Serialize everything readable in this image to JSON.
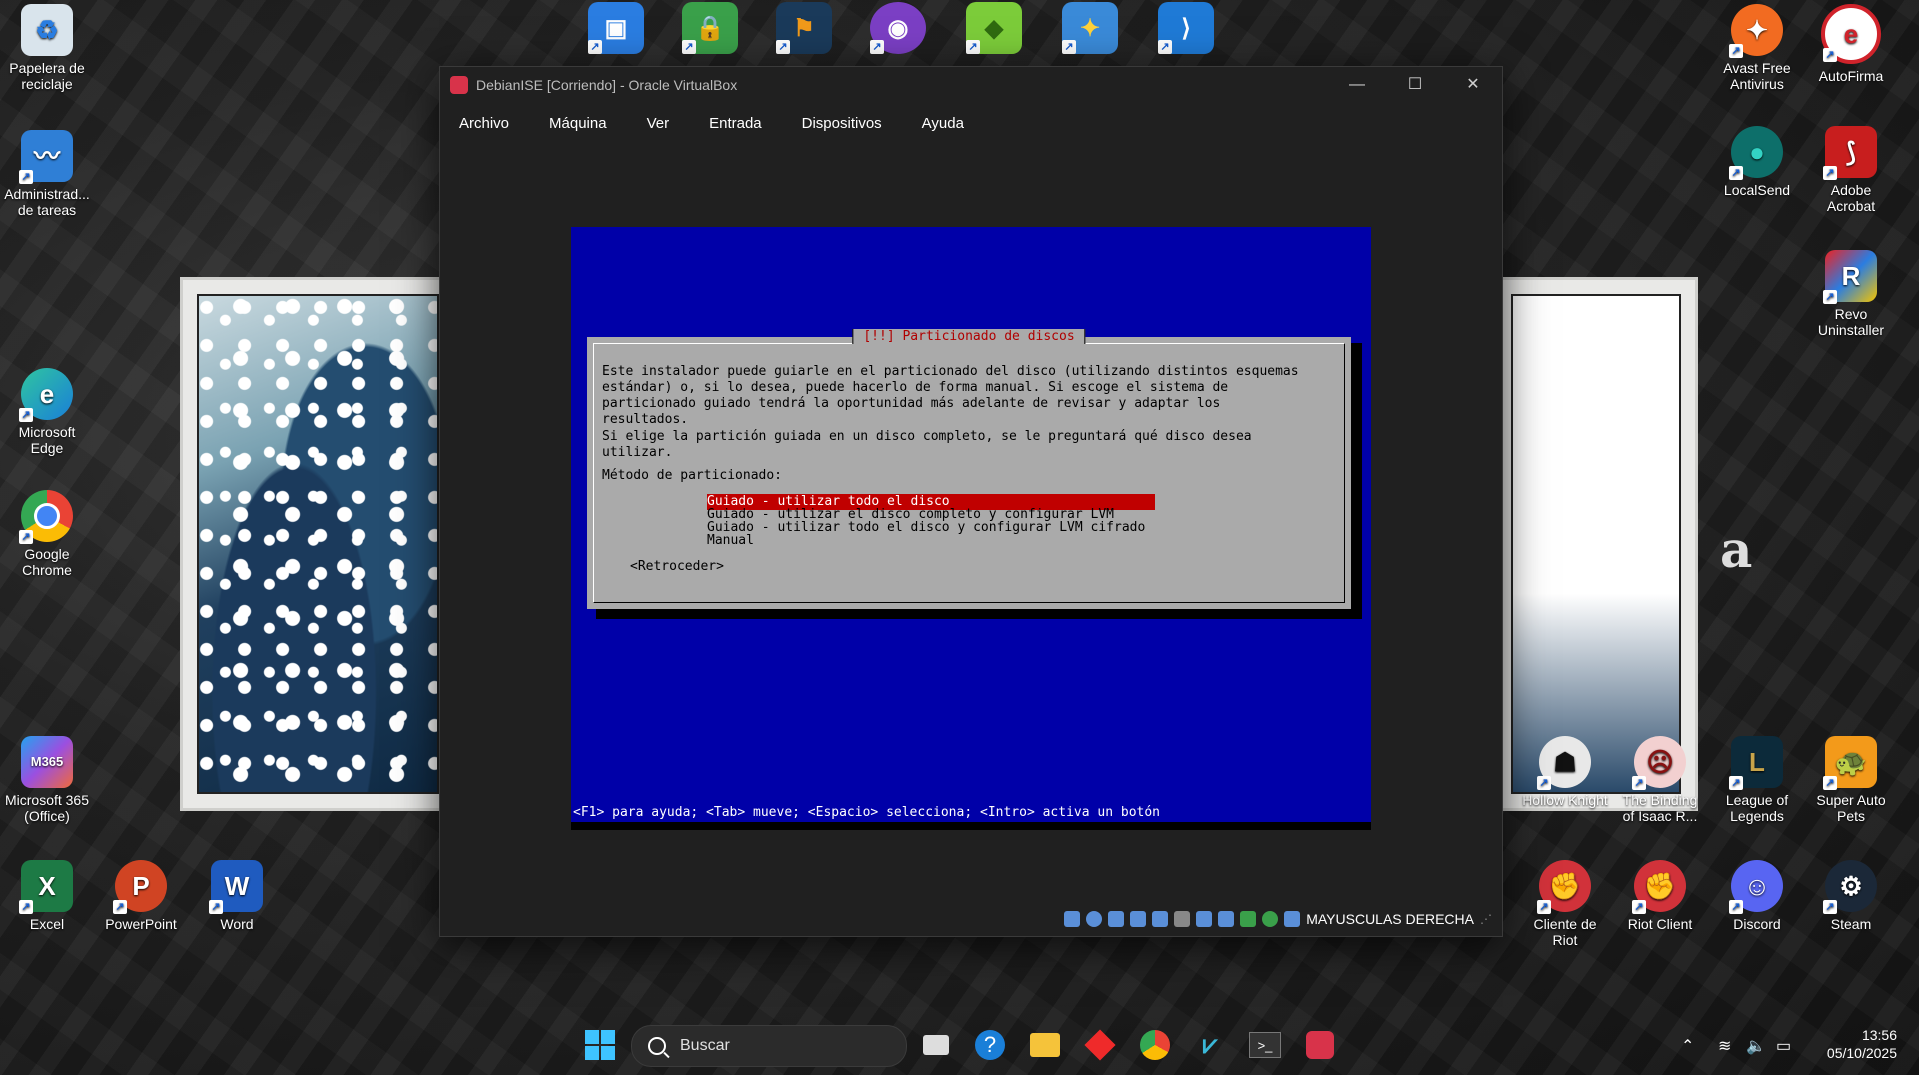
{
  "desktop": {
    "left": [
      "Papelera de reciclaje",
      "Administrad... de tareas",
      "Microsoft Edge",
      "Google Chrome",
      "Microsoft 365 (Office)",
      "Excel",
      "PowerPoint",
      "Word"
    ],
    "right": [
      "Avast Free Antivirus",
      "AutoFirma",
      "LocalSend",
      "Adobe Acrobat",
      "Revo Uninstaller",
      "Hollow Knight",
      "The Binding of Isaac R...",
      "League of Legends",
      "Super Auto Pets",
      "Cliente de Riot",
      "Riot Client",
      "Discord",
      "Steam"
    ],
    "m365_badge": "M365",
    "art_letter": "a"
  },
  "window": {
    "title": "DebianISE [Corriendo] - Oracle VirtualBox",
    "menu": [
      "Archivo",
      "Máquina",
      "Ver",
      "Entrada",
      "Dispositivos",
      "Ayuda"
    ],
    "host_key": "MAYUSCULAS DERECHA"
  },
  "installer": {
    "title": "[!!] Particionado de discos",
    "paragraph1": "Este instalador puede guiarle en el particionado del disco (utilizando distintos esquemas\nestándar) o, si lo desea, puede hacerlo de forma manual. Si escoge el sistema de\nparticionado guiado tendrá la oportunidad más adelante de revisar y adaptar los\nresultados.",
    "paragraph2": "Si elige la partición guiada en un disco completo, se le preguntará qué disco desea\nutilizar.",
    "method_label": "Método de particionado:",
    "options": [
      "Guiado - utilizar todo el disco",
      "Guiado - utilizar el disco completo y configurar LVM",
      "Guiado - utilizar todo el disco y configurar LVM cifrado",
      "Manual"
    ],
    "selected_option": 0,
    "back": "<Retroceder>",
    "help": "<F1> para ayuda; <Tab> mueve; <Espacio> selecciona; <Intro> activa un botón"
  },
  "taskbar": {
    "search": "Buscar",
    "time": "13:56",
    "date": "05/10/2025"
  },
  "colors": {
    "installer_background": "#0000a8",
    "dialog_background": "#aaaaaa",
    "selection": "#c00000",
    "dialog_title": "#b00000"
  }
}
